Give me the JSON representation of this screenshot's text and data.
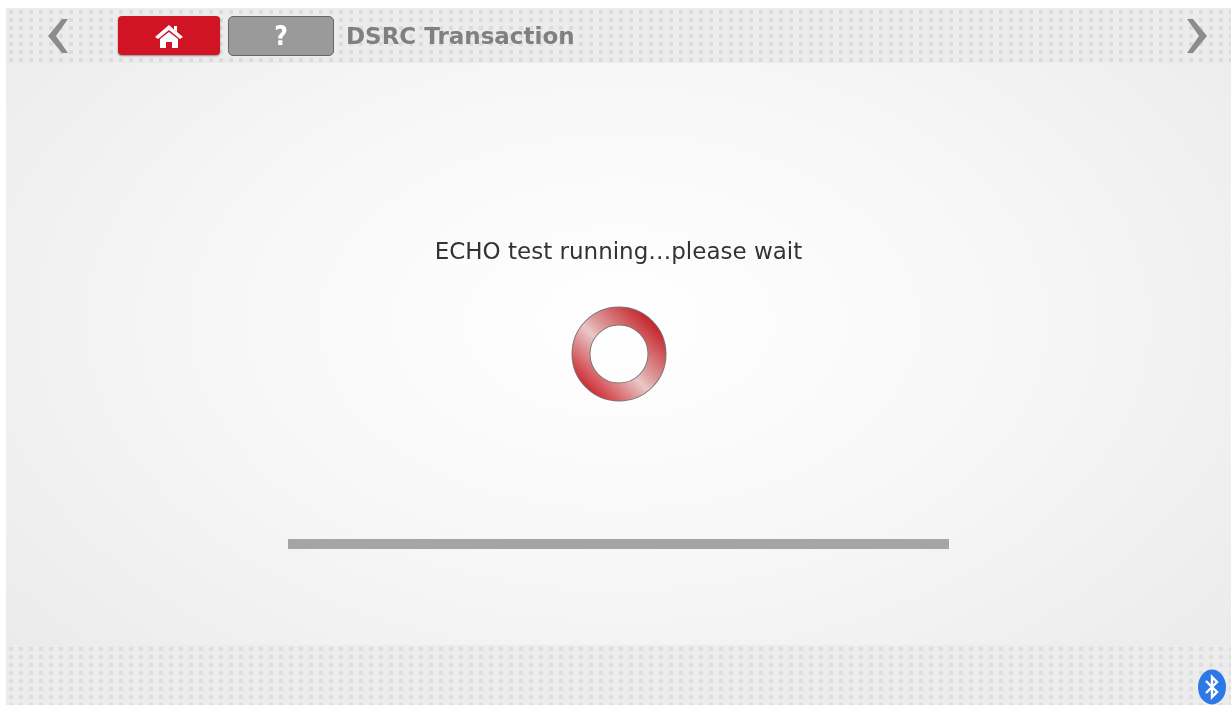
{
  "header": {
    "title": "DSRC Transaction"
  },
  "help_button": {
    "label": "?"
  },
  "message": "ECHO test running…please wait",
  "progress": {
    "level": 1
  }
}
